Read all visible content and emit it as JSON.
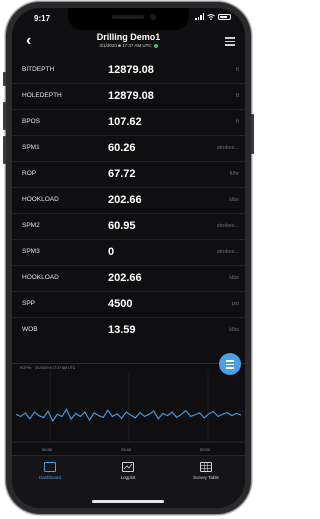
{
  "status": {
    "time": "9:17"
  },
  "header": {
    "title": "Drilling Demo1",
    "subtitle": "3/1/2020 ■ 17:37 AM UTC"
  },
  "rows": [
    {
      "label": "BITDEPTH",
      "value": "12879.08",
      "unit": "ft"
    },
    {
      "label": "HOLEDEPTH",
      "value": "12879.08",
      "unit": "ft"
    },
    {
      "label": "BPOS",
      "value": "107.62",
      "unit": "ft"
    },
    {
      "label": "SPM1",
      "value": "60.26",
      "unit": "strokes..."
    },
    {
      "label": "ROP",
      "value": "67.72",
      "unit": "ft/hr"
    },
    {
      "label": "HOOKLOAD",
      "value": "202.66",
      "unit": "klbs"
    },
    {
      "label": "SPM2",
      "value": "60.95",
      "unit": "strokes..."
    },
    {
      "label": "SPM3",
      "value": "0",
      "unit": "strokes..."
    },
    {
      "label": "HOOKLOAD",
      "value": "202.66",
      "unit": "klbs"
    },
    {
      "label": "SPP",
      "value": "4500",
      "unit": "psi"
    },
    {
      "label": "WOB",
      "value": "13.59",
      "unit": "klbs"
    }
  ],
  "trend": {
    "label": "ROP/hr · 3/1/2020 9:17:37 AM UTC",
    "ticks": [
      "09:30",
      "09:40",
      "09:50"
    ],
    "values": [
      0.55,
      0.5,
      0.58,
      0.45,
      0.6,
      0.52,
      0.48,
      0.62,
      0.4,
      0.55,
      0.5,
      0.66,
      0.44,
      0.57,
      0.5,
      0.6,
      0.42,
      0.58,
      0.52,
      0.48,
      0.64,
      0.5,
      0.56,
      0.46,
      0.6,
      0.53,
      0.47,
      0.59,
      0.5,
      0.55,
      0.62,
      0.45,
      0.57,
      0.52,
      0.6,
      0.48,
      0.55,
      0.63,
      0.5,
      0.54,
      0.58,
      0.47,
      0.56,
      0.61,
      0.5,
      0.55,
      0.59,
      0.52,
      0.57,
      0.53
    ]
  },
  "tabs": [
    {
      "label": "Dashboard",
      "active": true
    },
    {
      "label": "Logplot",
      "active": false
    },
    {
      "label": "Survey Table",
      "active": false
    }
  ]
}
